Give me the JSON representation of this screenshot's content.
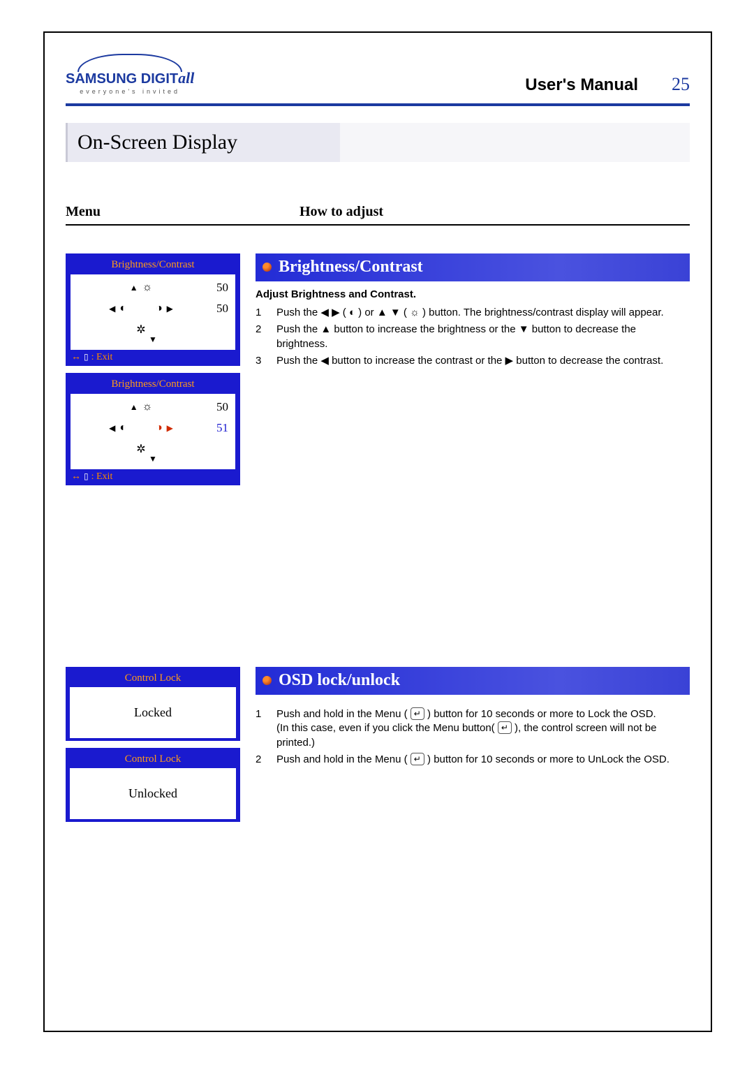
{
  "header": {
    "brand_main": "SAMSUNG DIGIT",
    "brand_italic": "all",
    "brand_tag": "everyone's invited",
    "manual_label": "User's Manual",
    "page_number": "25"
  },
  "page_title": "On-Screen Display",
  "subheads": {
    "menu": "Menu",
    "how": "How to adjust"
  },
  "osd_bc_title": "Brightness/Contrast",
  "osd_exit_label": ": Exit",
  "osd_box1": {
    "val_top": "50",
    "val_bot": "50"
  },
  "osd_box2": {
    "val_top": "50",
    "val_bot": "51"
  },
  "sec1": {
    "heading": "Brightness/Contrast",
    "sub": "Adjust Brightness and Contrast.",
    "step1": "Push the ◀ ▶ ( ◐ ) or ▲ ▼ ( ☼ ) button. The brightness/contrast display will appear.",
    "step2": "Push the ▲ button to increase the brightness or the ▼ button to decrease the brightness.",
    "step3": "Push the ◀ button to increase the contrast or the ▶ button to decrease the contrast."
  },
  "osd_ctrl_title": "Control Lock",
  "osd_locked": "Locked",
  "osd_unlocked": "Unlocked",
  "sec2": {
    "heading": "OSD lock/unlock",
    "step1a": "Push and hold in the Menu ( ",
    "step1b": " ) button for 10 seconds or more to Lock the OSD.",
    "step1c": "(In this case, even if you click the Menu button( ",
    "step1d": " ), the control screen will not be printed.)",
    "step2a": "Push and hold in the Menu ( ",
    "step2b": " ) button for 10 seconds or more to UnLock the OSD."
  },
  "icons": {
    "menu_btn": "↵"
  }
}
